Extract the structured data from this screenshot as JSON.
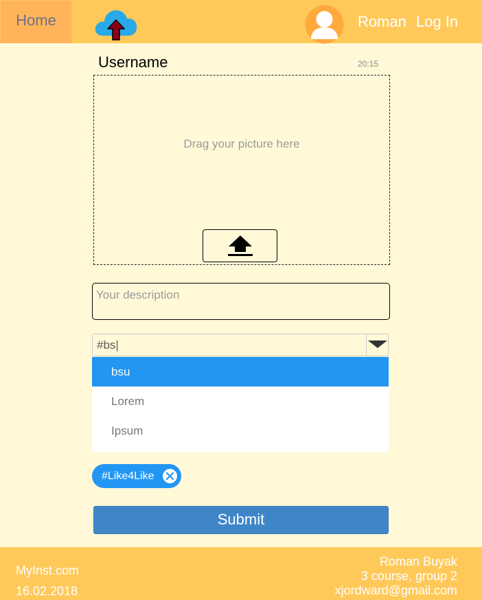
{
  "header": {
    "home_label": "Home",
    "user_name": "Roman",
    "login_label": "Log In",
    "logo_icon": "cloud-upload-icon",
    "avatar_icon": "user-avatar-icon"
  },
  "post": {
    "username": "Username",
    "time": "20:15",
    "drop_text": "Drag your picture here",
    "upload_icon": "upload-arrow-icon",
    "description_placeholder": "Your description"
  },
  "tags": {
    "input_value": "#bs|",
    "suggestions": [
      "bsu",
      "Lorem",
      "Ipsum"
    ],
    "selected_suggestion": "bsu",
    "chips": [
      {
        "label": "#Like4Like"
      }
    ]
  },
  "submit_label": "Submit",
  "footer": {
    "site": "MyInst.com",
    "date": "16.02.2018",
    "author": "Roman Buyak",
    "course": "3 course, group 2",
    "email": "xjordward@gmail.com"
  },
  "colors": {
    "header_bg": "#ffc95a",
    "home_bg": "#ffb45a",
    "page_bg": "#fff9d8",
    "accent_blue": "#2196f3",
    "submit_blue": "#3f86c8",
    "logo_arrow": "#8b0016"
  }
}
